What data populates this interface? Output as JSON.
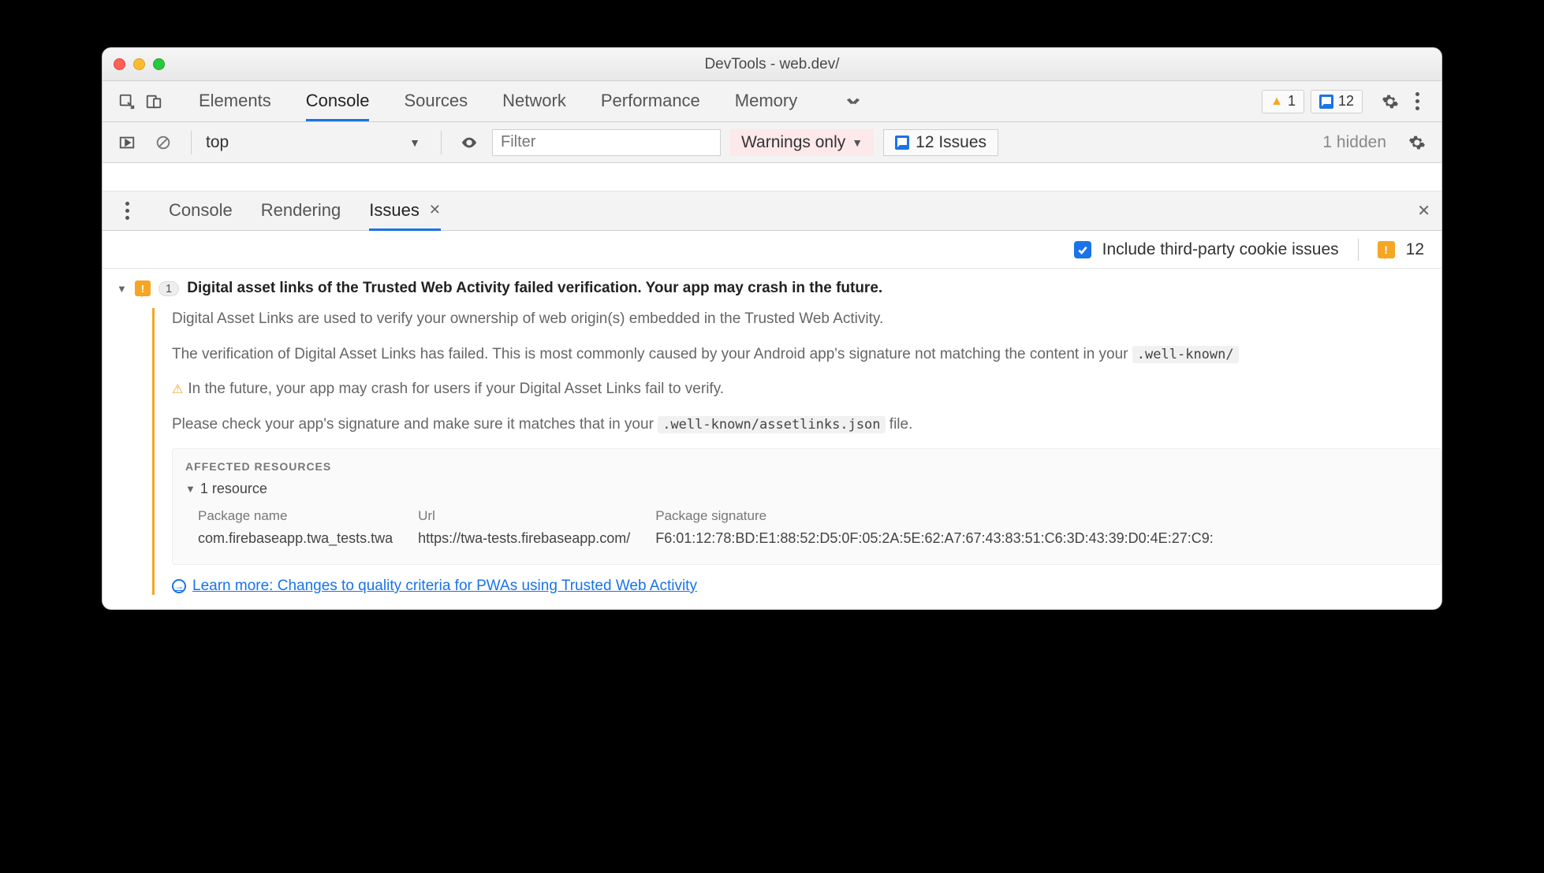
{
  "window": {
    "title": "DevTools - web.dev/"
  },
  "mainTabs": {
    "items": [
      "Elements",
      "Console",
      "Sources",
      "Network",
      "Performance",
      "Memory"
    ],
    "activeIndex": 1
  },
  "counters": {
    "warnings": "1",
    "issues": "12"
  },
  "consoleToolbar": {
    "context": "top",
    "filterPlaceholder": "Filter",
    "level": "Warnings only",
    "issuesButton": "12 Issues",
    "hidden": "1 hidden"
  },
  "drawerTabs": {
    "items": [
      "Console",
      "Rendering",
      "Issues"
    ],
    "activeIndex": 2
  },
  "includeRow": {
    "label": "Include third-party cookie issues",
    "count": "12"
  },
  "issue": {
    "count": "1",
    "title": "Digital asset links of the Trusted Web Activity failed verification. Your app may crash in the future.",
    "p1": "Digital Asset Links are used to verify your ownership of web origin(s) embedded in the Trusted Web Activity.",
    "p2_prefix": "The verification of Digital Asset Links has failed. This is most commonly caused by your Android app's signature not matching the content in your ",
    "p2_code": ".well-known/",
    "p3": "In the future, your app may crash for users if your Digital Asset Links fail to verify.",
    "p4_prefix": "Please check your app's signature and make sure it matches that in your ",
    "p4_code": ".well-known/assetlinks.json",
    "p4_suffix": " file.",
    "affected": {
      "heading": "AFFECTED RESOURCES",
      "summary": "1 resource",
      "columns": [
        "Package name",
        "Url",
        "Package signature"
      ],
      "row": {
        "package": "com.firebaseapp.twa_tests.twa",
        "url": "https://twa-tests.firebaseapp.com/",
        "sig": "F6:01:12:78:BD:E1:88:52:D5:0F:05:2A:5E:62:A7:67:43:83:51:C6:3D:43:39:D0:4E:27:C9:"
      }
    },
    "learnMore": "Learn more: Changes to quality criteria for PWAs using Trusted Web Activity"
  }
}
